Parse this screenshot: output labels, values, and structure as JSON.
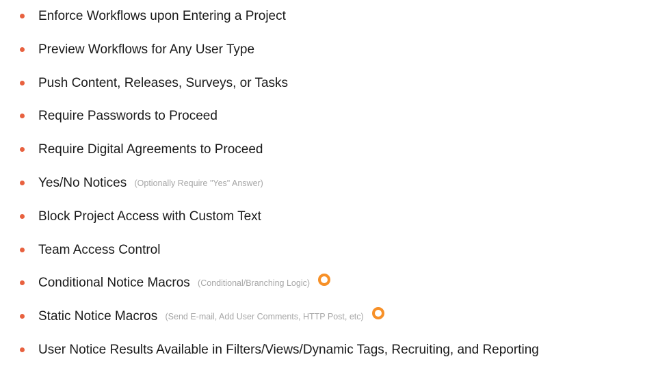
{
  "colors": {
    "bullet": "#e8613f",
    "addon_icon": "#f79027",
    "note_text": "#a6a6a6"
  },
  "features": [
    {
      "label": "Enforce Workflows upon Entering a Project"
    },
    {
      "label": "Preview Workflows for Any User Type"
    },
    {
      "label": "Push Content, Releases, Surveys, or Tasks"
    },
    {
      "label": "Require Passwords to Proceed"
    },
    {
      "label": "Require Digital Agreements to Proceed"
    },
    {
      "label": "Yes/No Notices",
      "note": "(Optionally Require \"Yes\" Answer)"
    },
    {
      "label": "Block Project Access with Custom Text"
    },
    {
      "label": "Team Access Control"
    },
    {
      "label": "Conditional Notice Macros",
      "note": "(Conditional/Branching Logic)",
      "icon": "orange-ring-icon"
    },
    {
      "label": "Static Notice Macros",
      "note": "(Send E-mail, Add User Comments, HTTP Post, etc)",
      "icon": "orange-ring-icon"
    },
    {
      "label": "User Notice Results Available in Filters/Views/Dynamic Tags, Recruiting, and Reporting"
    }
  ]
}
